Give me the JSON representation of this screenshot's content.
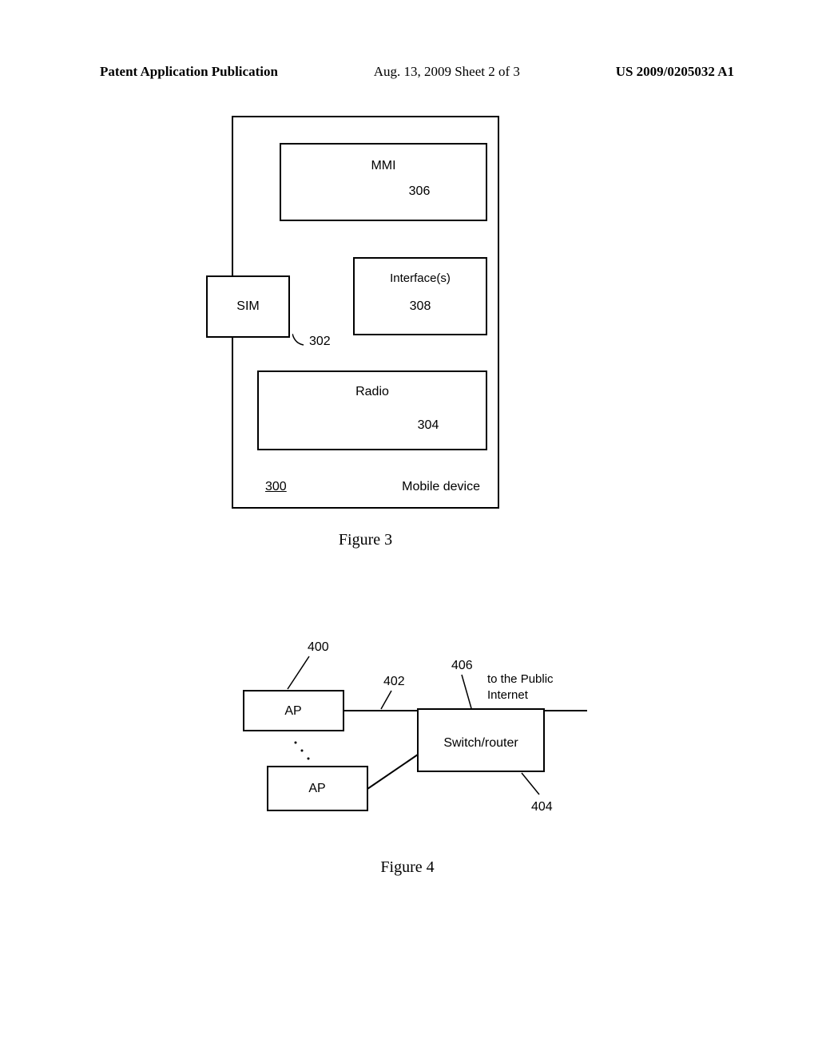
{
  "header": {
    "left": "Patent Application Publication",
    "center": "Aug. 13, 2009  Sheet 2 of 3",
    "right": "US 2009/0205032 A1"
  },
  "figure3": {
    "caption": "Figure 3",
    "mmi": {
      "label": "MMI",
      "ref": "306"
    },
    "interfaces": {
      "label": "Interface(s)",
      "ref": "308"
    },
    "sim": {
      "label": "SIM",
      "ref": "302"
    },
    "radio": {
      "label": "Radio",
      "ref": "304"
    },
    "device": {
      "ref": "300",
      "label": "Mobile device"
    }
  },
  "figure4": {
    "caption": "Figure 4",
    "ap1": {
      "label": "AP",
      "ref": "400"
    },
    "ap2": {
      "label": "AP"
    },
    "line_ref": "402",
    "switch": {
      "label": "Switch/router",
      "ref": "404"
    },
    "internet": {
      "label1": "to the Public",
      "label2": "Internet",
      "ref": "406"
    }
  },
  "chart_data": [
    {
      "type": "diagram",
      "title": "Figure 3 - Mobile device block diagram",
      "components": [
        {
          "id": "300",
          "name": "Mobile device",
          "contains": [
            "306",
            "308",
            "302",
            "304"
          ]
        },
        {
          "id": "306",
          "name": "MMI"
        },
        {
          "id": "308",
          "name": "Interface(s)"
        },
        {
          "id": "302",
          "name": "SIM"
        },
        {
          "id": "304",
          "name": "Radio"
        }
      ]
    },
    {
      "type": "diagram",
      "title": "Figure 4 - Network topology",
      "components": [
        {
          "id": "400",
          "name": "AP"
        },
        {
          "id": null,
          "name": "AP"
        },
        {
          "id": "404",
          "name": "Switch/router"
        }
      ],
      "connections": [
        {
          "from": "400",
          "to": "404",
          "ref": "402"
        },
        {
          "from": "AP2",
          "to": "404"
        },
        {
          "from": "404",
          "to": "Public Internet",
          "ref": "406"
        }
      ]
    }
  ]
}
